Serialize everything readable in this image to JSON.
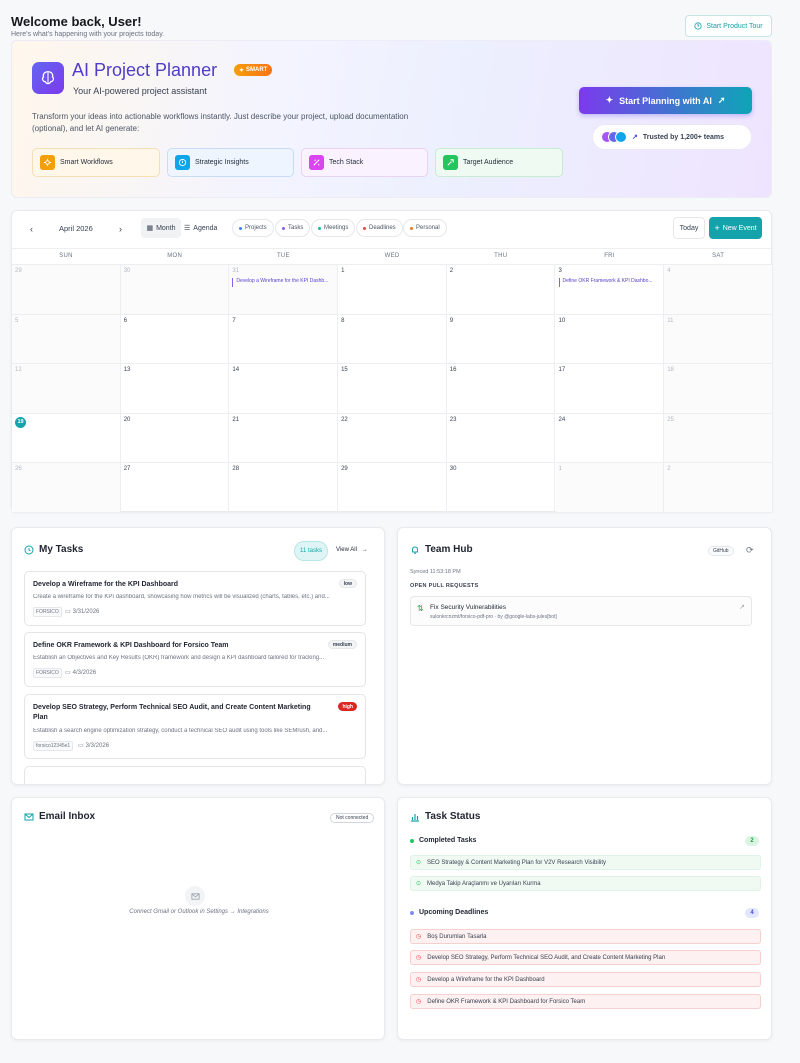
{
  "header": {
    "title": "Welcome back, User!",
    "subtitle": "Here's what's happening with your projects today.",
    "tour_label": "Start Product Tour"
  },
  "hero": {
    "title": "AI Project Planner",
    "badge": "SMART",
    "subtitle": "Your AI-powered project assistant",
    "description": "Transform your ideas into actionable workflows instantly. Just describe your project, upload documentation (optional), and let AI generate:",
    "features": [
      {
        "label": "Smart Workflows",
        "icon": "workflow-icon",
        "color": "#f59e0b"
      },
      {
        "label": "Strategic Insights",
        "icon": "insight-icon",
        "color": "#0ea5e9"
      },
      {
        "label": "Tech Stack",
        "icon": "tech-icon",
        "color": "#d946ef"
      },
      {
        "label": "Target Audience",
        "icon": "target-icon",
        "color": "#22c55e"
      }
    ],
    "cta_label": "Start Planning with AI",
    "trusted_label": "Trusted by 1,200+ teams"
  },
  "calendar": {
    "month_label": "April 2026",
    "views": [
      "Month",
      "Agenda"
    ],
    "filters": [
      {
        "label": "Projects",
        "color": "#3b82f6"
      },
      {
        "label": "Tasks",
        "color": "#8b5cf6"
      },
      {
        "label": "Meetings",
        "color": "#14b8a6"
      },
      {
        "label": "Deadlines",
        "color": "#ef4444"
      },
      {
        "label": "Personal",
        "color": "#f97316"
      }
    ],
    "today_label": "Today",
    "new_event_label": "New Event",
    "weekdays": [
      "SUN",
      "MON",
      "TUE",
      "WED",
      "THU",
      "FRI",
      "SAT"
    ],
    "weeks": [
      [
        {
          "d": "29",
          "out": true
        },
        {
          "d": "30",
          "out": true
        },
        {
          "d": "31",
          "out": true,
          "event": "Develop a Wireframe for the KPI Dashb..."
        },
        {
          "d": "1"
        },
        {
          "d": "2"
        },
        {
          "d": "3",
          "event": "Define OKR Framework & KPI Dashbo..."
        },
        {
          "d": "4",
          "out": true
        }
      ],
      [
        {
          "d": "5",
          "out": true
        },
        {
          "d": "6"
        },
        {
          "d": "7"
        },
        {
          "d": "8"
        },
        {
          "d": "9"
        },
        {
          "d": "10"
        },
        {
          "d": "11",
          "out": true
        }
      ],
      [
        {
          "d": "12",
          "out": true
        },
        {
          "d": "13"
        },
        {
          "d": "14"
        },
        {
          "d": "15"
        },
        {
          "d": "16"
        },
        {
          "d": "17"
        },
        {
          "d": "18",
          "out": true
        }
      ],
      [
        {
          "d": "19",
          "today": true
        },
        {
          "d": "20"
        },
        {
          "d": "21"
        },
        {
          "d": "22"
        },
        {
          "d": "23"
        },
        {
          "d": "24"
        },
        {
          "d": "25",
          "out": true
        }
      ],
      [
        {
          "d": "26",
          "out": true
        },
        {
          "d": "27"
        },
        {
          "d": "28"
        },
        {
          "d": "29"
        },
        {
          "d": "30"
        },
        {
          "d": "1",
          "out": true
        },
        {
          "d": "2",
          "out": true
        }
      ]
    ]
  },
  "my_tasks": {
    "title": "My Tasks",
    "count_label": "11 tasks",
    "view_all": "View All",
    "items": [
      {
        "title": "Develop a Wireframe for the KPI Dashboard",
        "desc": "Create a wireframe for the KPI dashboard, showcasing how metrics will be visualized (charts, tables, etc.) and...",
        "tag": "FORSICO",
        "date": "3/31/2026",
        "priority": "low"
      },
      {
        "title": "Define OKR Framework & KPI Dashboard for Forsico Team",
        "desc": "Establish an Objectives and Key Results (OKR) framework and design a KPI dashboard tailored for tracking...",
        "tag": "FORSICO",
        "date": "4/3/2026",
        "priority": "medium"
      },
      {
        "title": "Develop SEO Strategy, Perform Technical SEO Audit, and Create Content Marketing Plan",
        "desc": "Establish a search engine optimization strategy, conduct a technical SEO audit using tools like SEMrush, and...",
        "tag": "forsico12345e1",
        "date": "3/3/2026",
        "priority": "high"
      }
    ]
  },
  "team_hub": {
    "title": "Team Hub",
    "badge": "GitHub",
    "synced": "Synced 11:53:18 PM",
    "section": "OPEN PULL REQUESTS",
    "pr_title": "Fix Security Vulnerabilities",
    "pr_meta": "sulonkrcnzmt/forsico-pdf-pro · by @google-labs-jules[bot]"
  },
  "email": {
    "title": "Email Inbox",
    "badge": "Not connected",
    "empty": "Connect Gmail or Outlook in Settings → Integrations"
  },
  "task_status": {
    "title": "Task Status",
    "completed_label": "Completed Tasks",
    "completed_count": "2",
    "completed": [
      "SEO Strategy & Content Marketing Plan for V2V Research Visibility",
      "Medya Takip Araçlanmı ve Uyarıları Kurma"
    ],
    "upcoming_label": "Upcoming Deadlines",
    "upcoming_count": "4",
    "upcoming": [
      "Boş Durumları Tasarla",
      "Develop SEO Strategy, Perform Technical SEO Audit, and Create Content Marketing Plan",
      "Develop a Wireframe for the KPI Dashboard",
      "Define OKR Framework & KPI Dashboard for Forsico Team"
    ]
  }
}
